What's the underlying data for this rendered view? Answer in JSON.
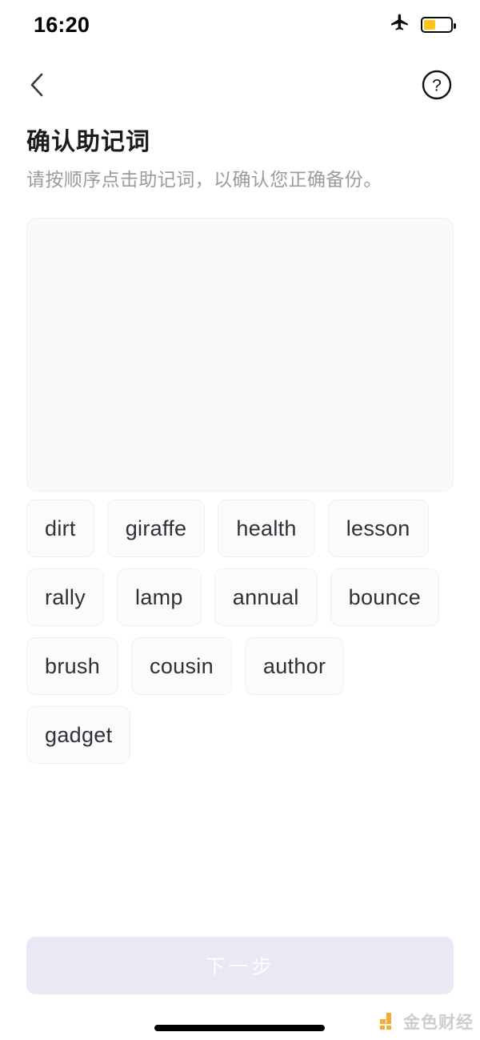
{
  "status_bar": {
    "time": "16:20",
    "airplane_icon": "airplane-mode-icon",
    "battery_icon": "battery-icon",
    "battery_level_percent": 45,
    "battery_color": "#FCC419"
  },
  "nav": {
    "back_icon": "chevron-left-icon",
    "help_icon": "question-mark-circle-icon"
  },
  "heading": {
    "title": "确认助记词",
    "subtitle": "请按顺序点击助记词，以确认您正确备份。"
  },
  "answer_area": {
    "selected_words": [],
    "background_color": "#fafafa"
  },
  "word_pool": {
    "words": [
      "dirt",
      "giraffe",
      "health",
      "lesson",
      "rally",
      "lamp",
      "annual",
      "bounce",
      "brush",
      "cousin",
      "author",
      "gadget"
    ]
  },
  "footer": {
    "next_label": "下一步",
    "next_enabled": false,
    "next_bg_color": "#e9e9f5",
    "next_text_color": "#fdfdff"
  },
  "watermark": {
    "text": "金色财经",
    "logo_icon": "jinse-finance-logo-icon",
    "logo_color": "#F5A623"
  }
}
